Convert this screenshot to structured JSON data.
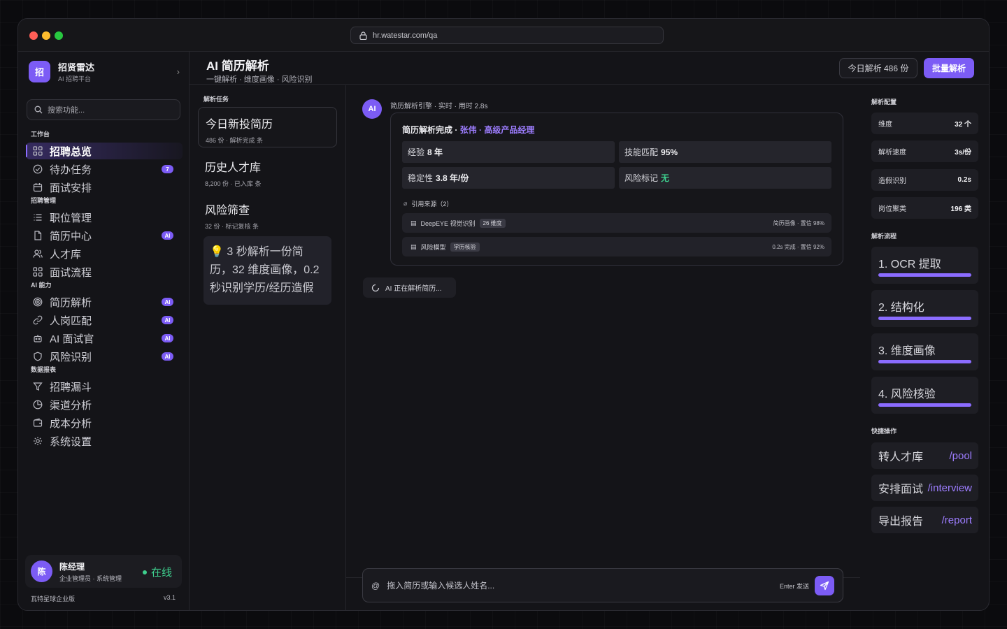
{
  "browser": {
    "url": "hr.watestar.com/qa"
  },
  "brand": {
    "logo": "招",
    "name": "招贤雷达",
    "sub": "AI 招聘平台"
  },
  "search": {
    "placeholder": "搜索功能..."
  },
  "sections": {
    "work": "工作台",
    "recruit": "招聘管理",
    "ai": "AI 能力",
    "report": "数据报表"
  },
  "nav": [
    {
      "label": "招聘总览",
      "icon": "grid-icon"
    },
    {
      "label": "待办任务",
      "icon": "check-circle-icon",
      "badge": "7"
    },
    {
      "label": "面试安排",
      "icon": "calendar-icon"
    },
    {
      "label": "职位管理",
      "icon": "list-icon"
    },
    {
      "label": "简历中心",
      "icon": "file-icon",
      "badge": "AI"
    },
    {
      "label": "人才库",
      "icon": "users-icon"
    },
    {
      "label": "面试流程",
      "icon": "grid-icon"
    },
    {
      "label": "简历解析",
      "icon": "target-icon",
      "badge": "AI"
    },
    {
      "label": "人岗匹配",
      "icon": "link-icon",
      "badge": "AI"
    },
    {
      "label": "AI 面试官",
      "icon": "robot-icon",
      "badge": "AI"
    },
    {
      "label": "风险识别",
      "icon": "shield-icon",
      "badge": "AI"
    },
    {
      "label": "招聘漏斗",
      "icon": "filter-icon"
    },
    {
      "label": "渠道分析",
      "icon": "pie-icon"
    },
    {
      "label": "成本分析",
      "icon": "wallet-icon"
    },
    {
      "label": "系统设置",
      "icon": "gear-icon"
    }
  ],
  "user": {
    "avatar": "陈",
    "name": "陈经理",
    "role": "企业管理员 · 系统管理",
    "status": "在线"
  },
  "footer": {
    "edition": "瓦特星球企业版",
    "version": "v3.1"
  },
  "header": {
    "title": "AI 简历解析",
    "subtitle": "一键解析 · 维度画像 · 风险识别",
    "today_btn": "今日解析 486 份",
    "batch_btn": "批量解析"
  },
  "tasks": {
    "label": "解析任务",
    "items": [
      {
        "title": "今日新投简历",
        "meta": "486 份 · 解析完成 条"
      },
      {
        "title": "历史人才库",
        "meta": "8,200 份 · 已入库 条"
      },
      {
        "title": "风险筛查",
        "meta": "32 份 · 标记复核 条"
      }
    ],
    "tip": "💡 3 秒解析一份简历，32 维度画像，0.2 秒识别学历/经历造假"
  },
  "chat": {
    "ai_avatar": "AI",
    "engine": "简历解析引擎 · 实时 · 用时 2.8s",
    "head_prefix": "简历解析完成 · ",
    "head_highlight": "张伟 · 高级产品经理",
    "stats": [
      {
        "label": "经验",
        "value": "8 年"
      },
      {
        "label": "技能匹配",
        "value": "95%"
      },
      {
        "label": "稳定性",
        "value": "3.8 年/份"
      },
      {
        "label": "风险标记",
        "value": "无"
      }
    ],
    "cite_label": "引用来源（2）",
    "citations": [
      {
        "name": "DeepEYE 视觉识别",
        "tag": "26 维度",
        "right": "简历画像 · 置信 98%"
      },
      {
        "name": "风险模型",
        "tag": "学历核验",
        "right": "0.2s 完成 · 置信 92%"
      }
    ],
    "thinking": "AI 正在解析简历...",
    "composer_placeholder": "拖入简历或输入候选人姓名...",
    "enter_hint": "Enter 发送"
  },
  "right": {
    "config_label": "解析配置",
    "config": [
      {
        "label": "维度",
        "value": "32 个"
      },
      {
        "label": "解析速度",
        "value": "3s/份"
      },
      {
        "label": "造假识别",
        "value": "0.2s"
      },
      {
        "label": "岗位聚类",
        "value": "196 类"
      }
    ],
    "flow_label": "解析流程",
    "steps": [
      {
        "label": "1. OCR 提取",
        "progress": 1.0
      },
      {
        "label": "2. 结构化",
        "progress": 1.0
      },
      {
        "label": "3. 维度画像",
        "progress": 1.0
      },
      {
        "label": "4. 风险核验",
        "progress": 1.0
      }
    ],
    "actions_label": "快捷操作",
    "actions": [
      {
        "label": "转人才库",
        "path": "/pool"
      },
      {
        "label": "安排面试",
        "path": "/interview"
      },
      {
        "label": "导出报告",
        "path": "/report"
      }
    ]
  },
  "colors": {
    "accent": "#7c5cf5",
    "success": "#3ecf8e"
  }
}
